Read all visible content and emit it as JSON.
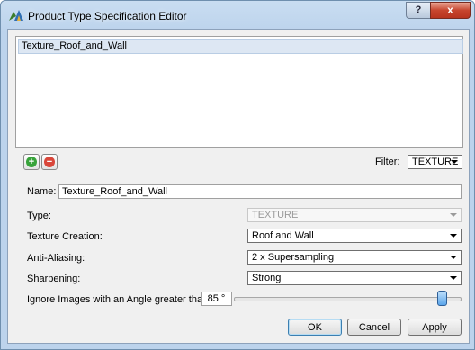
{
  "window": {
    "title": "Product Type Specification Editor",
    "help_label": "?",
    "close_label": "x"
  },
  "list": {
    "items": [
      {
        "label": "Texture_Roof_and_Wall",
        "selected": true
      }
    ]
  },
  "toolbar": {
    "add_icon": "plus-circle-icon",
    "remove_icon": "minus-circle-icon",
    "filter_label": "Filter:",
    "filter_value": "TEXTURE"
  },
  "form": {
    "name_label": "Name:",
    "name_value": "Texture_Roof_and_Wall",
    "type_label": "Type:",
    "type_value": "TEXTURE",
    "texture_creation_label": "Texture Creation:",
    "texture_creation_value": "Roof and Wall",
    "anti_aliasing_label": "Anti-Aliasing:",
    "anti_aliasing_value": "2 x Supersampling",
    "sharpening_label": "Sharpening:",
    "sharpening_value": "Strong",
    "angle_label": "Ignore Images with an Angle greater than:",
    "angle_value": "85 °",
    "angle_slider_fraction": 0.94
  },
  "buttons": {
    "ok": "OK",
    "cancel": "Cancel",
    "apply": "Apply"
  },
  "colors": {
    "add_green": "#37a33a",
    "remove_red": "#d9463a",
    "title_gradient_top": "#c9ddf1"
  }
}
